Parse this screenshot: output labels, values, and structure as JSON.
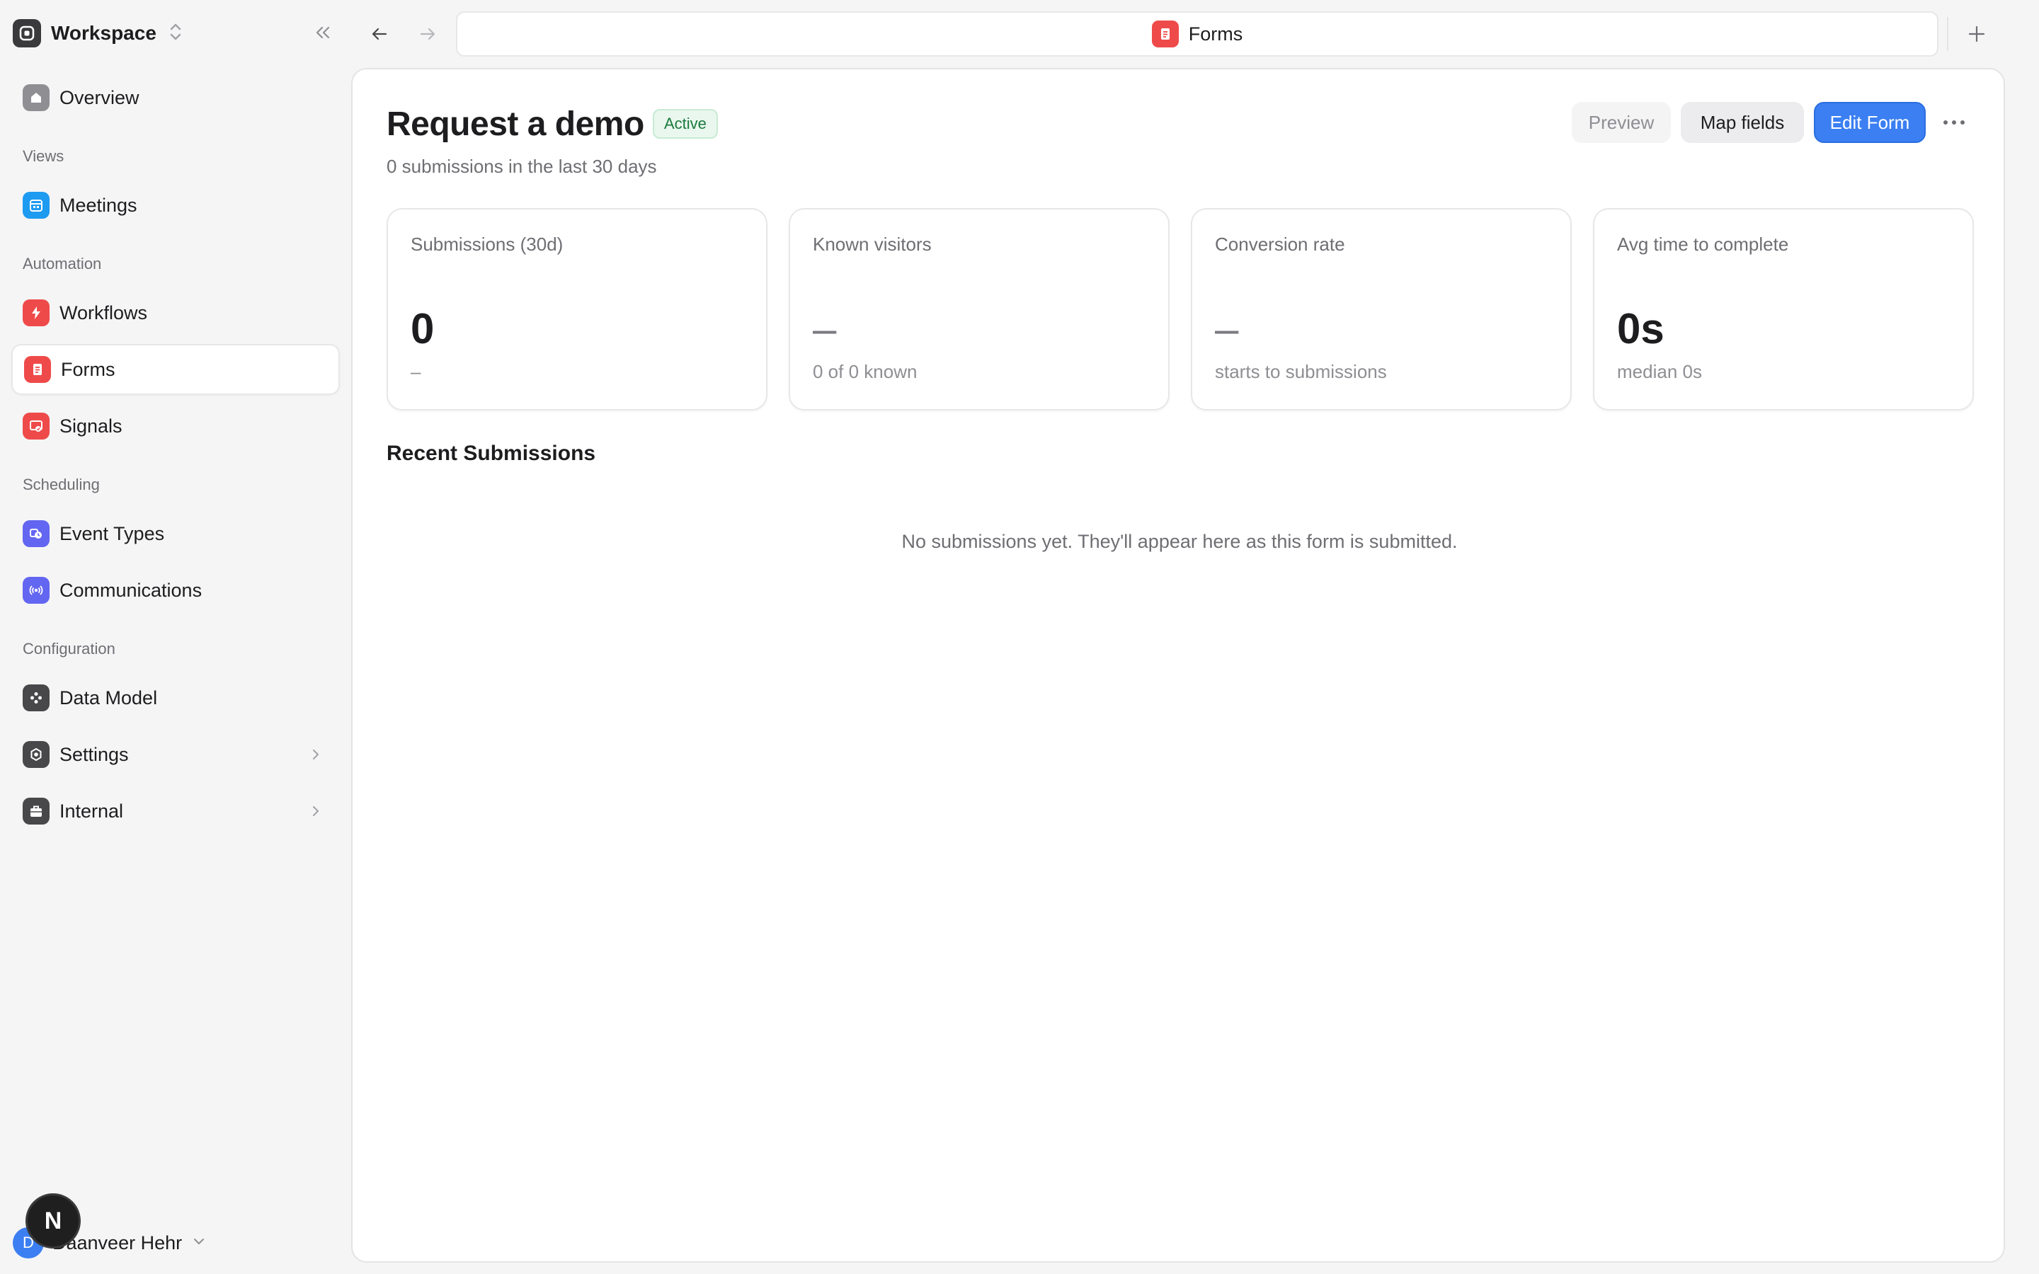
{
  "workspace": {
    "name": "Workspace"
  },
  "sidebar": {
    "overview": "Overview",
    "sections": {
      "views": "Views",
      "automation": "Automation",
      "scheduling": "Scheduling",
      "configuration": "Configuration"
    },
    "items": [
      {
        "label": "Meetings",
        "icon": "calendar-icon",
        "color": "#1d9bf0"
      },
      {
        "label": "Workflows",
        "icon": "bolt-icon",
        "color": "#ef4a4a"
      },
      {
        "label": "Forms",
        "icon": "form-icon",
        "color": "#ef4a4a",
        "active": true
      },
      {
        "label": "Signals",
        "icon": "signal-icon",
        "color": "#ef4a4a"
      },
      {
        "label": "Event Types",
        "icon": "event-icon",
        "color": "#6366f1"
      },
      {
        "label": "Communications",
        "icon": "broadcast-icon",
        "color": "#6366f1"
      },
      {
        "label": "Data Model",
        "icon": "data-model-icon",
        "color": "#48484a"
      },
      {
        "label": "Settings",
        "icon": "gear-icon",
        "color": "#48484a"
      },
      {
        "label": "Internal",
        "icon": "briefcase-icon",
        "color": "#48484a"
      }
    ],
    "user": {
      "initial": "D",
      "name": "Daanveer Hehr"
    },
    "dev_badge": "N"
  },
  "topbar": {
    "tab_label": "Forms"
  },
  "page": {
    "title": "Request a demo",
    "status": "Active",
    "subtitle": "0 submissions in the last 30 days",
    "buttons": {
      "preview": "Preview",
      "map_fields": "Map fields",
      "edit_form": "Edit Form"
    },
    "stats": [
      {
        "label": "Submissions (30d)",
        "value": "0",
        "sub": "–"
      },
      {
        "label": "Known visitors",
        "value": "–",
        "sub": "0 of 0 known"
      },
      {
        "label": "Conversion rate",
        "value": "–",
        "sub": "starts to submissions"
      },
      {
        "label": "Avg time to complete",
        "value": "0s",
        "sub": "median 0s"
      }
    ],
    "recent_title": "Recent Submissions",
    "empty_message": "No submissions yet. They'll appear here as this form is submitted."
  },
  "colors": {
    "accent": "#3b7ff2",
    "active_badge": "#1b7a3e",
    "forms_red": "#ef4a4a"
  }
}
